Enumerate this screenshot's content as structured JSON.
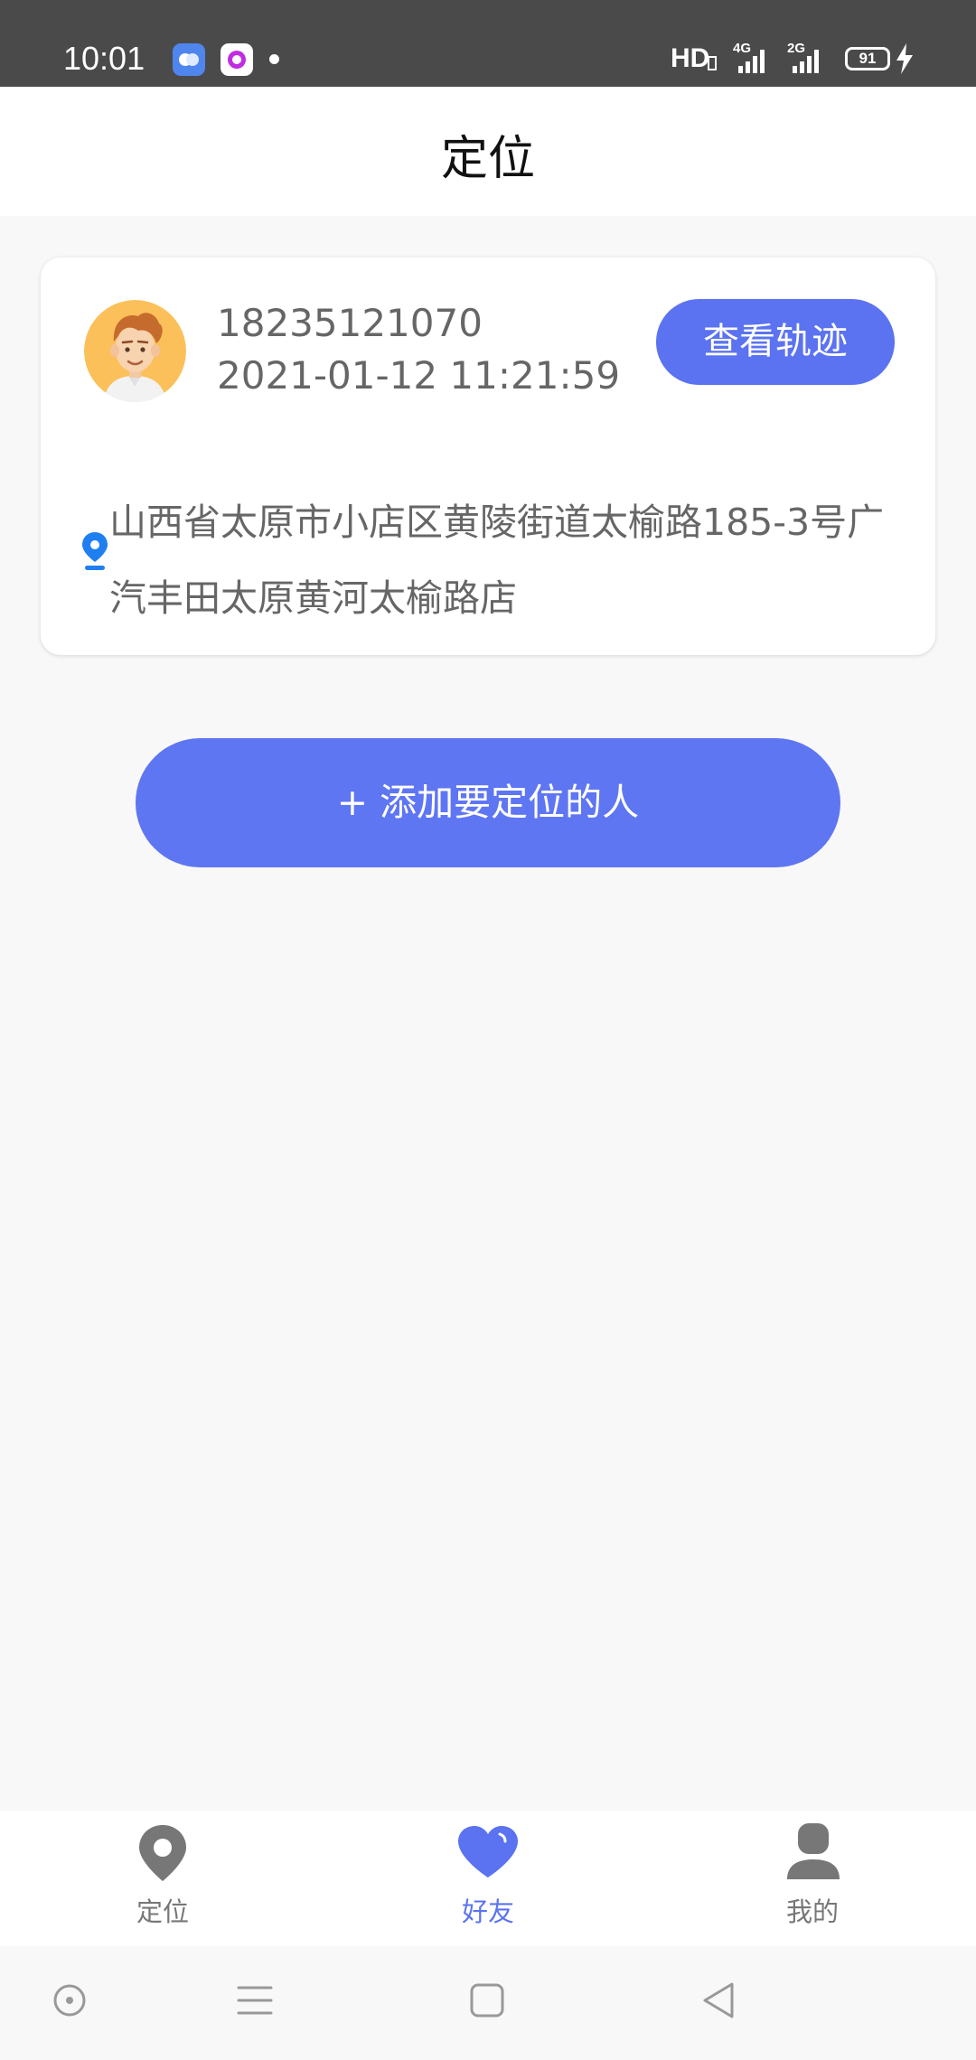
{
  "status_bar": {
    "time": "10:01",
    "network_type": "HD",
    "signal1_label": "4G",
    "signal2_label": "2G",
    "battery": "91"
  },
  "header": {
    "title": "定位"
  },
  "friend_card": {
    "phone": "18235121070",
    "timestamp": "2021-01-12 11:21:59",
    "track_button_label": "查看轨迹",
    "address": "山西省太原市小店区黄陵街道太榆路185-3号广汽丰田太原黄河太榆路店"
  },
  "add_button_label": "+  添加要定位的人",
  "tabs": [
    {
      "label": "定位",
      "icon": "location-pin-icon",
      "active": false
    },
    {
      "label": "好友",
      "icon": "heart-icon",
      "active": true
    },
    {
      "label": "我的",
      "icon": "person-icon",
      "active": false
    }
  ],
  "colors": {
    "accent": "#5b73f0",
    "status_bar_bg": "#4b4a4b",
    "page_bg": "#f8f8f8",
    "text_gray": "#666666",
    "pin_blue": "#1f7ff0"
  }
}
